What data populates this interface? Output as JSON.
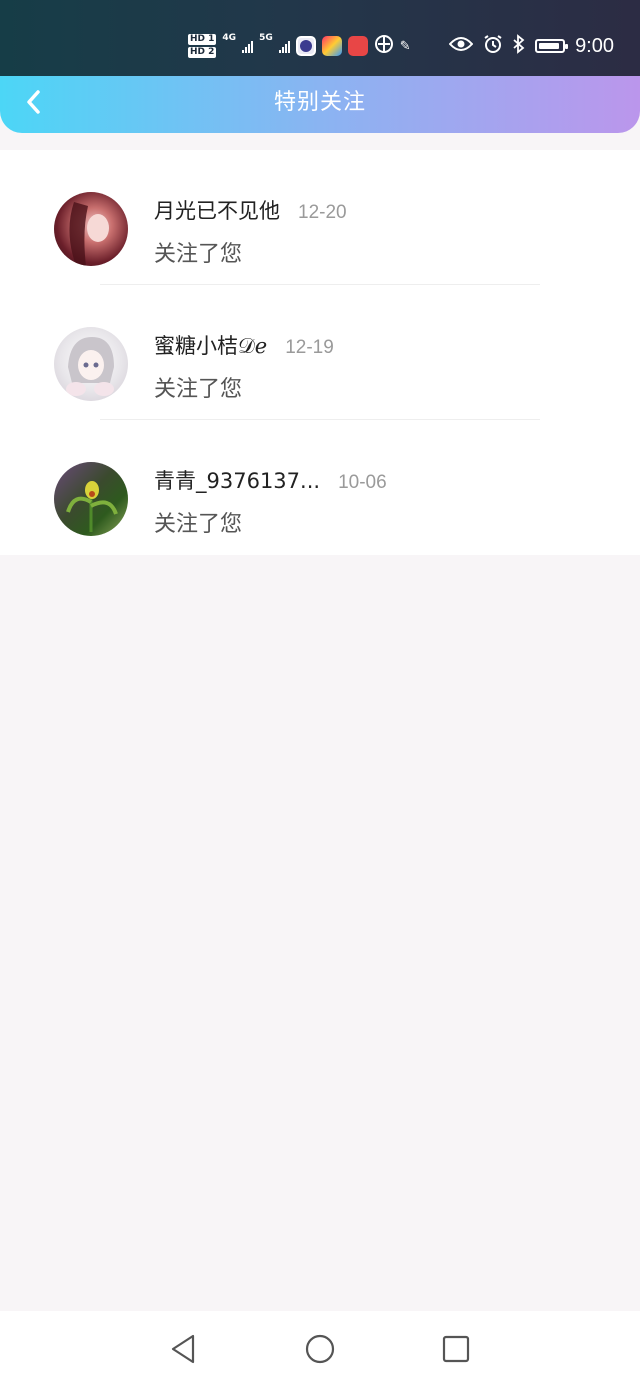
{
  "status_bar": {
    "sim1": "HD 1",
    "sim2": "HD 2",
    "net1": "4G",
    "net2": "5G",
    "time": "9:00",
    "battery_level": 0.9,
    "icons": [
      "signal-icon",
      "app-icon",
      "app-icon",
      "huawei-icon",
      "vpn-icon",
      "eye-icon",
      "alarm-icon",
      "bluetooth-icon",
      "battery-icon"
    ]
  },
  "header": {
    "title": "特别关注",
    "back_icon": "chevron-left-icon"
  },
  "list": {
    "items": [
      {
        "name": "月光已不见他",
        "date": "12-20",
        "action": "关注了您"
      },
      {
        "name": "蜜糖小桔𝒟ℯ",
        "date": "12-19",
        "action": "关注了您"
      },
      {
        "name": "青青_9376137...",
        "date": "10-06",
        "action": "关注了您"
      }
    ]
  },
  "nav": {
    "back": "triangle-back-icon",
    "home": "circle-home-icon",
    "recent": "square-recent-icon"
  }
}
